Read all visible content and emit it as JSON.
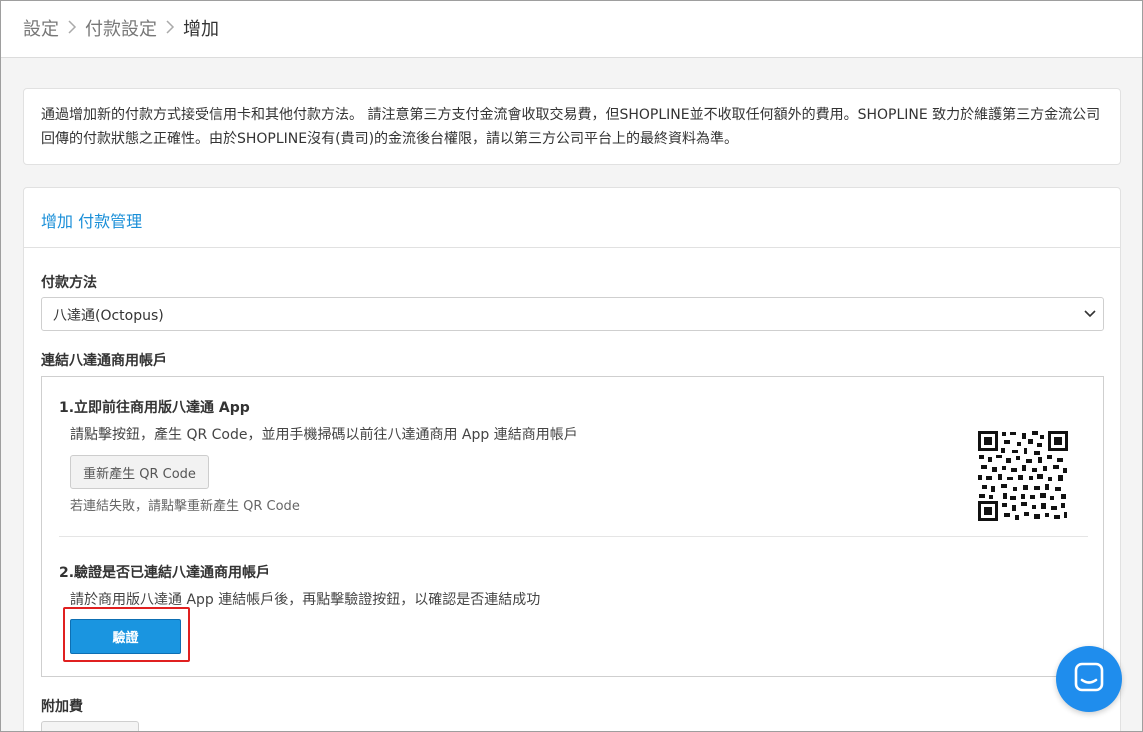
{
  "breadcrumb": {
    "items": [
      "設定",
      "付款設定",
      "增加"
    ]
  },
  "notice": {
    "text": "通過增加新的付款方式接受信用卡和其他付款方法。 請注意第三方支付金流會收取交易費，但SHOPLINE並不收取任何額外的費用。SHOPLINE 致力於維護第三方金流公司回傳的付款狀態之正確性。由於SHOPLINE沒有(貴司)的金流後台權限，請以第三方公司平台上的最終資料為準。"
  },
  "panel": {
    "title": "增加 付款管理",
    "payment_method_label": "付款方法",
    "payment_method_value": "八達通(Octopus)",
    "connect_label": "連結八達通商用帳戶",
    "step1": {
      "title": "1.立即前往商用版八達通 App",
      "desc": "請點擊按鈕，產生 QR Code，並用手機掃碼以前往八達通商用 App 連結商用帳戶",
      "button": "重新產生 QR Code",
      "hint": "若連結失敗，請點擊重新產生 QR Code"
    },
    "step2": {
      "title": "2.驗證是否已連結八達通商用帳戶",
      "desc": "請於商用版八達通 App 連結帳戶後，再點擊驗證按鈕，以確認是否連結成功",
      "button": "驗證"
    },
    "extra_fee_label": "附加費"
  },
  "colors": {
    "accent": "#1a8fd8",
    "verify_button": "#1a95e0",
    "highlight_border": "#e02020",
    "chat_button": "#1f8ded"
  },
  "icons": {
    "breadcrumb_separator": "chevron-right-icon",
    "select_caret": "chevron-down-icon",
    "chat": "chat-icon",
    "qr": "qr-code"
  }
}
